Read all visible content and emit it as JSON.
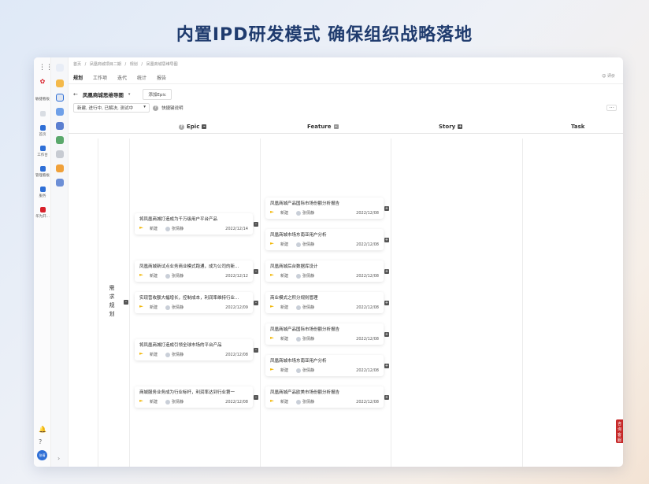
{
  "headline": "内置IPD研发模式 确保组织战略落地",
  "rail": {
    "items": [
      {
        "label": "敏捷看板",
        "color": "#2f6fd6"
      },
      {
        "label": "首页",
        "color": "#2f6fd6"
      },
      {
        "label": "工作台",
        "color": "#2f6fd6"
      },
      {
        "label": "管理看板",
        "color": "#2f6fd6"
      },
      {
        "label": "服务",
        "color": "#2f6fd6"
      },
      {
        "label": "华为开...",
        "color": "#d8212b"
      }
    ],
    "avatar": "张倩"
  },
  "breadcrumb": [
    "首页",
    "/",
    "凤凰商城项目二期",
    "/",
    "规划",
    "/",
    "凤凰商城思维导图"
  ],
  "tabs": [
    "规划",
    "工作项",
    "迭代",
    "统计",
    "报告"
  ],
  "feedback": "评价",
  "page": {
    "title": "凤凰商城思维导图",
    "add_button": "添加Epic",
    "filter_value": "新建, 进行中, 已解决, 测试中",
    "help_link": "快捷键说明",
    "more": "···"
  },
  "columns": [
    "Epic",
    "Feature",
    "Story",
    "Task"
  ],
  "row_label": [
    "需",
    "求",
    "规",
    "划"
  ],
  "epics": [
    {
      "title": "将凤凰商城打造成为千万级用户平台产品",
      "status": "新建",
      "user": "张倩静",
      "date": "2022/12/14"
    },
    {
      "title": "凤凰商城新试点业务商业模式跑通，成为公司的新...",
      "status": "新建",
      "user": "张倩静",
      "date": "2022/12/12"
    },
    {
      "title": "实现营收额大幅增长，控制成本，利润率维持行业...",
      "status": "新建",
      "user": "张倩静",
      "date": "2022/12/09"
    },
    {
      "title": "将凤凰商城打造成引领全球市场的平台产品",
      "status": "新建",
      "user": "张倩静",
      "date": "2022/12/08"
    },
    {
      "title": "商城服务业务成为行业标杆，利润率达到行业第一",
      "status": "新建",
      "user": "张倩静",
      "date": "2022/12/08"
    }
  ],
  "features": [
    {
      "title": "凤凰商城产品国际市场份额分析报告",
      "status": "新建",
      "user": "张倩静",
      "date": "2022/12/08"
    },
    {
      "title": "凤凰商城市场东南亚用户分析",
      "status": "新建",
      "user": "张倩静",
      "date": "2022/12/08"
    },
    {
      "title": "凤凰商城后台数据库设计",
      "status": "新建",
      "user": "张倩静",
      "date": "2022/12/08"
    },
    {
      "title": "商业模式之积分规则管理",
      "status": "新建",
      "user": "张倩静",
      "date": "2022/12/08"
    },
    {
      "title": "凤凰商城产品国际市场份额分析报告",
      "status": "新建",
      "user": "张倩静",
      "date": "2022/12/08"
    },
    {
      "title": "凤凰商城市场东南亚用户分析",
      "status": "新建",
      "user": "张倩静",
      "date": "2022/12/08"
    },
    {
      "title": "凤凰商城产品欧美市场份额分析报告",
      "status": "新建",
      "user": "张倩静",
      "date": "2022/12/08"
    }
  ],
  "side_tag": "咨询客服"
}
